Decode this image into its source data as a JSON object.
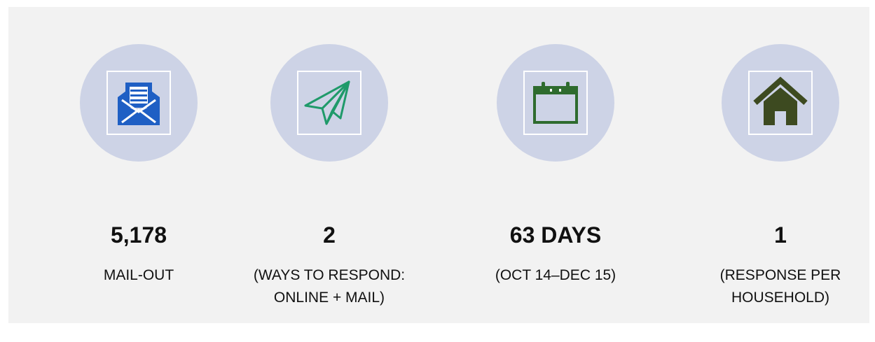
{
  "stats": [
    {
      "value": "5,178",
      "label": "MAIL-OUT",
      "icon": "envelope-icon",
      "color": "#1f5fc4"
    },
    {
      "value": "2",
      "label": "(WAYS TO RESPOND:\nONLINE + MAIL)",
      "icon": "paper-plane-icon",
      "color": "#1f9a6a"
    },
    {
      "value": "63 DAYS",
      "label": "(OCT 14–DEC 15)",
      "icon": "calendar-icon",
      "color": "#2e6b2e"
    },
    {
      "value": "1",
      "label": "(RESPONSE PER\nHOUSEHOLD)",
      "icon": "house-icon",
      "color": "#3d4a20"
    }
  ]
}
